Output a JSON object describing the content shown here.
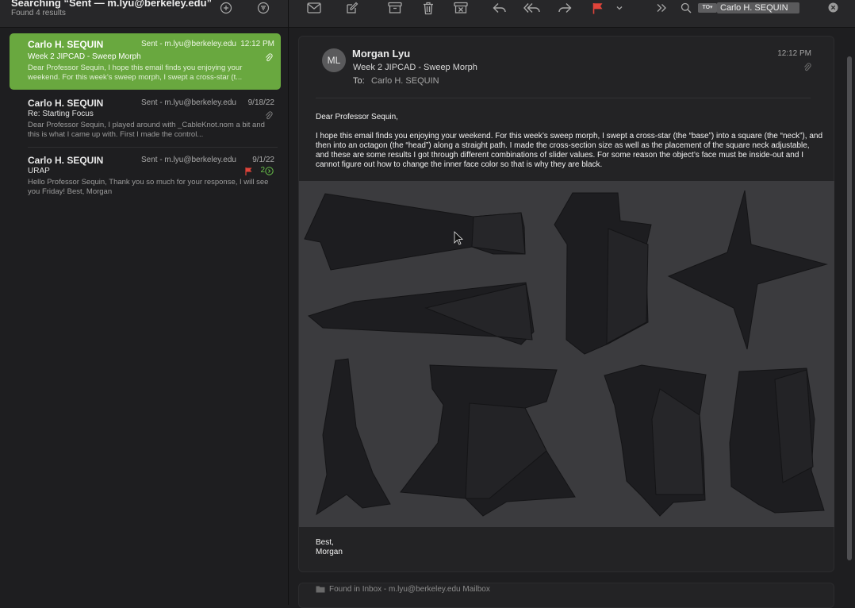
{
  "sidebar": {
    "title": "Searching “Sent — m.lyu@berkeley.edu”",
    "subtitle": "Found 4 results",
    "messages": [
      {
        "from": "Carlo H. SEQUIN",
        "account": "Sent - m.lyu@berkeley.edu",
        "date": "12:12 PM",
        "subject": "Week 2 JIPCAD - Sweep Morph",
        "preview": "Dear Professor Sequin, I hope this email finds you enjoying your weekend. For this week’s sweep morph, I swept a cross-star (t...",
        "selected": true,
        "attachment": true
      },
      {
        "from": "Carlo H. SEQUIN",
        "account": "Sent - m.lyu@berkeley.edu",
        "date": "9/18/22",
        "subject": "Re: Starting Focus",
        "preview": "Dear Professor Sequin, I played around with _CableKnot.nom a bit and this is what I came up with. First I made the control...",
        "selected": false,
        "attachment": true
      },
      {
        "from": "Carlo H. SEQUIN",
        "account": "Sent - m.lyu@berkeley.edu",
        "date": "9/1/22",
        "subject": "URAP",
        "preview": "Hello Professor Sequin, Thank you so much for your response, I will see you Friday! Best, Morgan",
        "selected": false,
        "flagged": true,
        "thread_count": "2"
      }
    ]
  },
  "search": {
    "scope": "TO",
    "token": "Carlo H. SEQUIN"
  },
  "email": {
    "initials": "ML",
    "sender": "Morgan Lyu",
    "subject": "Week 2 JIPCAD - Sweep Morph",
    "to_label": "To:",
    "to": "Carlo H. SEQUIN",
    "time": "12:12 PM",
    "greeting": "Dear Professor Sequin,",
    "paragraph": "I hope this email finds you enjoying your weekend. For this week’s sweep morph, I swept a cross-star (the “base”) into a square (the “neck”), and then into an octagon (the “head”) along a straight path. I made the cross-section size as well as the placement of the square neck adjustable, and these are some results I got through different combinations of slider values. For some reason the object’s face must be inside-out and I cannot figure out how to change the inner face color so that is why they are black.",
    "closing": "Best,",
    "signature": "Morgan"
  },
  "found_in": "Found in Inbox - m.lyu@berkeley.edu Mailbox",
  "colors": {
    "accent": "#69a83f",
    "flag": "#e0443a",
    "shape": "#1d1d20"
  }
}
